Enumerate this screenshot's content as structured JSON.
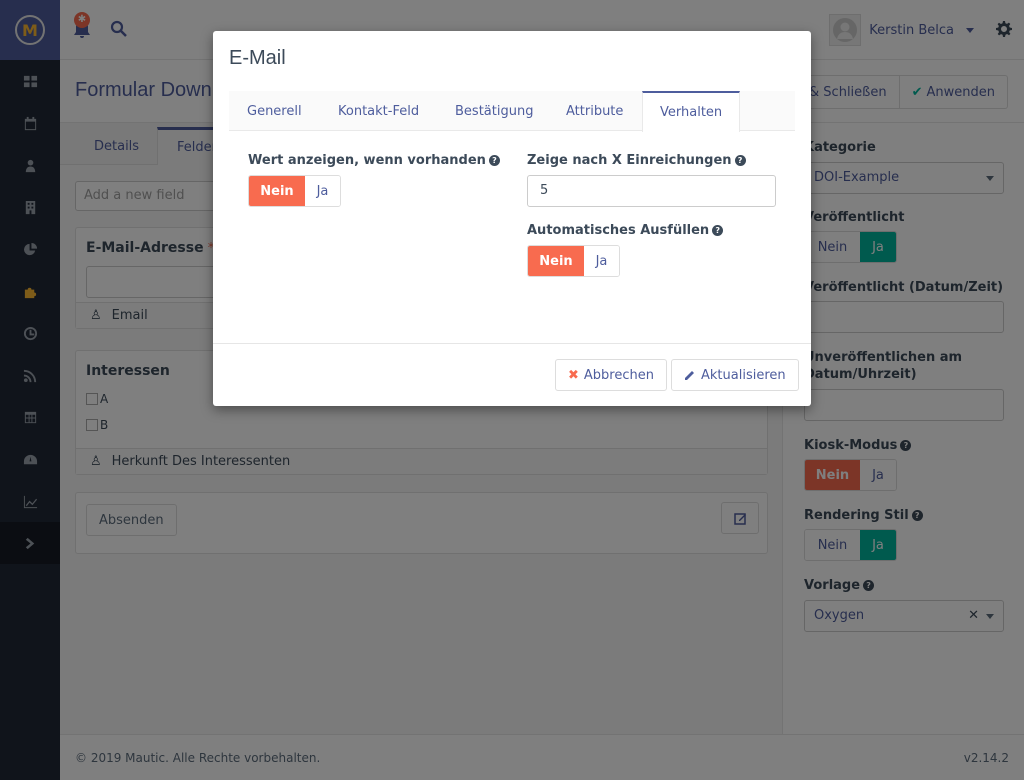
{
  "sidebar": {
    "brand": "M",
    "items": [
      {
        "name": "dashboard",
        "icon": "grid-icon"
      },
      {
        "name": "calendar",
        "icon": "calendar-icon"
      },
      {
        "name": "contacts",
        "icon": "user-icon"
      },
      {
        "name": "companies",
        "icon": "building-icon"
      },
      {
        "name": "segments",
        "icon": "pie-chart-icon"
      },
      {
        "name": "components",
        "icon": "puzzle-icon",
        "active": true
      },
      {
        "name": "campaigns",
        "icon": "clock-icon"
      },
      {
        "name": "channels",
        "icon": "rss-icon"
      },
      {
        "name": "points",
        "icon": "calculator-icon"
      },
      {
        "name": "stages",
        "icon": "dashboard-gauge-icon"
      },
      {
        "name": "reports",
        "icon": "line-chart-icon"
      }
    ],
    "collapse_icon": "chevron-right-icon"
  },
  "header": {
    "notification_badge": "✱",
    "user_name": "Kerstin Belca"
  },
  "pagehead": {
    "title": "Formular Download",
    "save_close_label": "Speichern & Schließen",
    "apply_label": "Anwenden"
  },
  "main": {
    "tabs": [
      {
        "label": "Details"
      },
      {
        "label": "Felder",
        "active": true
      }
    ],
    "add_field_placeholder": "Add a new field",
    "fields": [
      {
        "label": "E-Mail-Adresse",
        "required": true,
        "mapping": "Email"
      },
      {
        "label": "Interessen",
        "options": [
          "A",
          "B"
        ],
        "mapping": "Herkunft Des Interessenten"
      }
    ],
    "submit_label": "Absenden"
  },
  "rpanel": {
    "category_label": "Kategorie",
    "category_value": "DOI-Example",
    "published_label": "Veröffentlicht",
    "published_value": "Ja",
    "publish_up_label": "Veröffentlicht (Datum/Zeit)",
    "publish_up_value": "",
    "publish_down_label_1": "Unveröffentlichen am",
    "publish_down_label_2": "Datum/Uhrzeit)",
    "publish_down_value": "",
    "kiosk_label": "Kiosk-Modus",
    "kiosk_value": "Nein",
    "render_style_label": "Rendering Stil",
    "render_style_value": "Ja",
    "template_label": "Vorlage",
    "template_value": "Oxygen",
    "no": "Nein",
    "yes": "Ja"
  },
  "footer": {
    "copyright": "© 2019 Mautic. Alle Rechte vorbehalten.",
    "version": "v2.14.2"
  },
  "modal": {
    "title": "E-Mail",
    "tabs": [
      {
        "label": "Generell"
      },
      {
        "label": "Kontakt-Feld"
      },
      {
        "label": "Bestätigung"
      },
      {
        "label": "Attribute"
      },
      {
        "label": "Verhalten",
        "active": true
      }
    ],
    "show_when_value_exists_label": "Wert anzeigen, wenn vorhanden",
    "show_when_value_exists_value": "Nein",
    "show_after_x_label": "Zeige nach X Einreichungen",
    "show_after_x_value": "5",
    "autofill_label": "Automatisches Ausfüllen",
    "autofill_value": "Nein",
    "no": "Nein",
    "yes": "Ja",
    "cancel_label": "Abbrechen",
    "update_label": "Aktualisieren"
  },
  "colors": {
    "brand": "#4e5d9d",
    "danger": "#f86b4f",
    "success": "#00b49c",
    "accent": "#fdb933"
  }
}
